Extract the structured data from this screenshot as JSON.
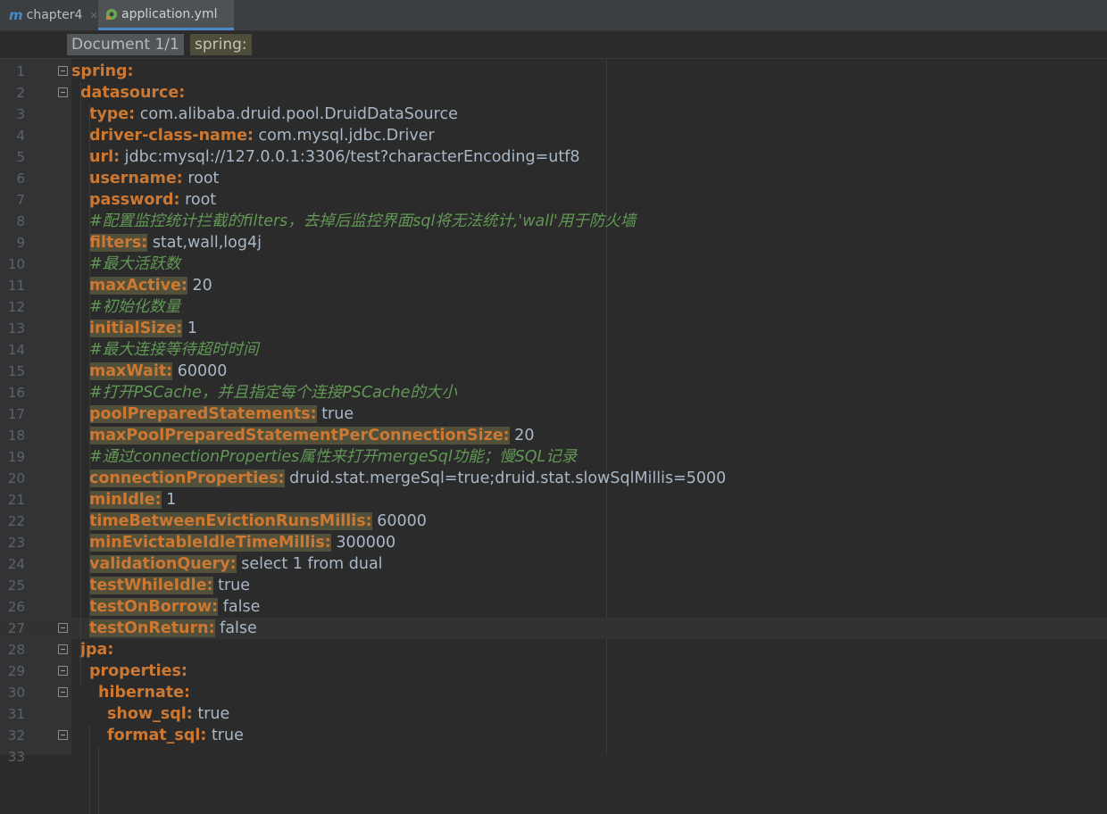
{
  "tabs": [
    {
      "label": "chapter4",
      "icon": "m-module-icon"
    },
    {
      "label": "application.yml",
      "icon": "spring-leaf-icon"
    }
  ],
  "breadcrumbs": [
    "Document 1/1",
    "spring:"
  ],
  "editor": {
    "lines": [
      {
        "n": "1",
        "indent": 0,
        "key": "spring:",
        "value": "",
        "type": "kv",
        "fold": true
      },
      {
        "n": "2",
        "indent": 1,
        "key": "datasource:",
        "value": "",
        "type": "kv",
        "fold": true
      },
      {
        "n": "3",
        "indent": 2,
        "key": "type:",
        "value": " com.alibaba.druid.pool.DruidDataSource",
        "type": "kv"
      },
      {
        "n": "4",
        "indent": 2,
        "key": "driver-class-name:",
        "value": " com.mysql.jdbc.Driver",
        "type": "kv"
      },
      {
        "n": "5",
        "indent": 2,
        "key": "url:",
        "value": " jdbc:mysql://127.0.0.1:3306/test?characterEncoding=utf8",
        "type": "kv"
      },
      {
        "n": "6",
        "indent": 2,
        "key": "username:",
        "value": " root",
        "type": "kv"
      },
      {
        "n": "7",
        "indent": 2,
        "key": "password:",
        "value": " root",
        "type": "kv"
      },
      {
        "n": "8",
        "indent": 2,
        "comment": "#配置监控统计拦截的filters，去掉后监控界面sql将无法统计,'wall'用于防火墙",
        "type": "comment"
      },
      {
        "n": "9",
        "indent": 2,
        "key": "filters:",
        "value": " stat,wall,log4j",
        "type": "kv",
        "hl": true
      },
      {
        "n": "10",
        "indent": 2,
        "comment": "#最大活跃数",
        "type": "comment"
      },
      {
        "n": "11",
        "indent": 2,
        "key": "maxActive:",
        "value": " 20",
        "type": "kv",
        "hl": true
      },
      {
        "n": "12",
        "indent": 2,
        "comment": "#初始化数量",
        "type": "comment"
      },
      {
        "n": "13",
        "indent": 2,
        "key": "initialSize:",
        "value": " 1",
        "type": "kv",
        "hl": true
      },
      {
        "n": "14",
        "indent": 2,
        "comment": "#最大连接等待超时时间",
        "type": "comment"
      },
      {
        "n": "15",
        "indent": 2,
        "key": "maxWait:",
        "value": " 60000",
        "type": "kv",
        "hl": true
      },
      {
        "n": "16",
        "indent": 2,
        "comment": "#打开PSCache，并且指定每个连接PSCache的大小",
        "type": "comment"
      },
      {
        "n": "17",
        "indent": 2,
        "key": "poolPreparedStatements:",
        "value": " true",
        "type": "kv",
        "hl": true
      },
      {
        "n": "18",
        "indent": 2,
        "key": "maxPoolPreparedStatementPerConnectionSize:",
        "value": " 20",
        "type": "kv",
        "hl": true
      },
      {
        "n": "19",
        "indent": 2,
        "comment": "#通过connectionProperties属性来打开mergeSql功能；慢SQL记录",
        "type": "comment"
      },
      {
        "n": "20",
        "indent": 2,
        "key": "connectionProperties:",
        "value": " druid.stat.mergeSql=true;druid.stat.slowSqlMillis=5000",
        "type": "kv",
        "hl": true
      },
      {
        "n": "21",
        "indent": 2,
        "key": "minIdle:",
        "value": " 1",
        "type": "kv",
        "hl": true
      },
      {
        "n": "22",
        "indent": 2,
        "key": "timeBetweenEvictionRunsMillis:",
        "value": " 60000",
        "type": "kv",
        "hl": true
      },
      {
        "n": "23",
        "indent": 2,
        "key": "minEvictableIdleTimeMillis:",
        "value": " 300000",
        "type": "kv",
        "hl": true
      },
      {
        "n": "24",
        "indent": 2,
        "key": "validationQuery:",
        "value": " select 1 from dual",
        "type": "kv",
        "hl": true
      },
      {
        "n": "25",
        "indent": 2,
        "key": "testWhileIdle:",
        "value": " true",
        "type": "kv",
        "hl": true
      },
      {
        "n": "26",
        "indent": 2,
        "key": "testOnBorrow:",
        "value": " false",
        "type": "kv",
        "hl": true
      },
      {
        "n": "27",
        "indent": 2,
        "key": "testOnReturn:",
        "value": " false",
        "type": "kv",
        "hl": true,
        "fold": true,
        "current": true
      },
      {
        "n": "28",
        "indent": 1,
        "key": "jpa:",
        "value": "",
        "type": "kv",
        "fold": true
      },
      {
        "n": "29",
        "indent": 2,
        "key": "properties:",
        "value": "",
        "type": "kv",
        "fold": true
      },
      {
        "n": "30",
        "indent": 3,
        "key": "hibernate:",
        "value": "",
        "type": "kv",
        "fold": true
      },
      {
        "n": "31",
        "indent": 4,
        "key": "show_sql:",
        "value": " true",
        "type": "kv"
      },
      {
        "n": "32",
        "indent": 4,
        "key": "format_sql:",
        "value": " true",
        "type": "kv",
        "fold": true
      },
      {
        "n": "33",
        "indent": 0,
        "key": "",
        "value": "",
        "type": "empty"
      }
    ]
  }
}
